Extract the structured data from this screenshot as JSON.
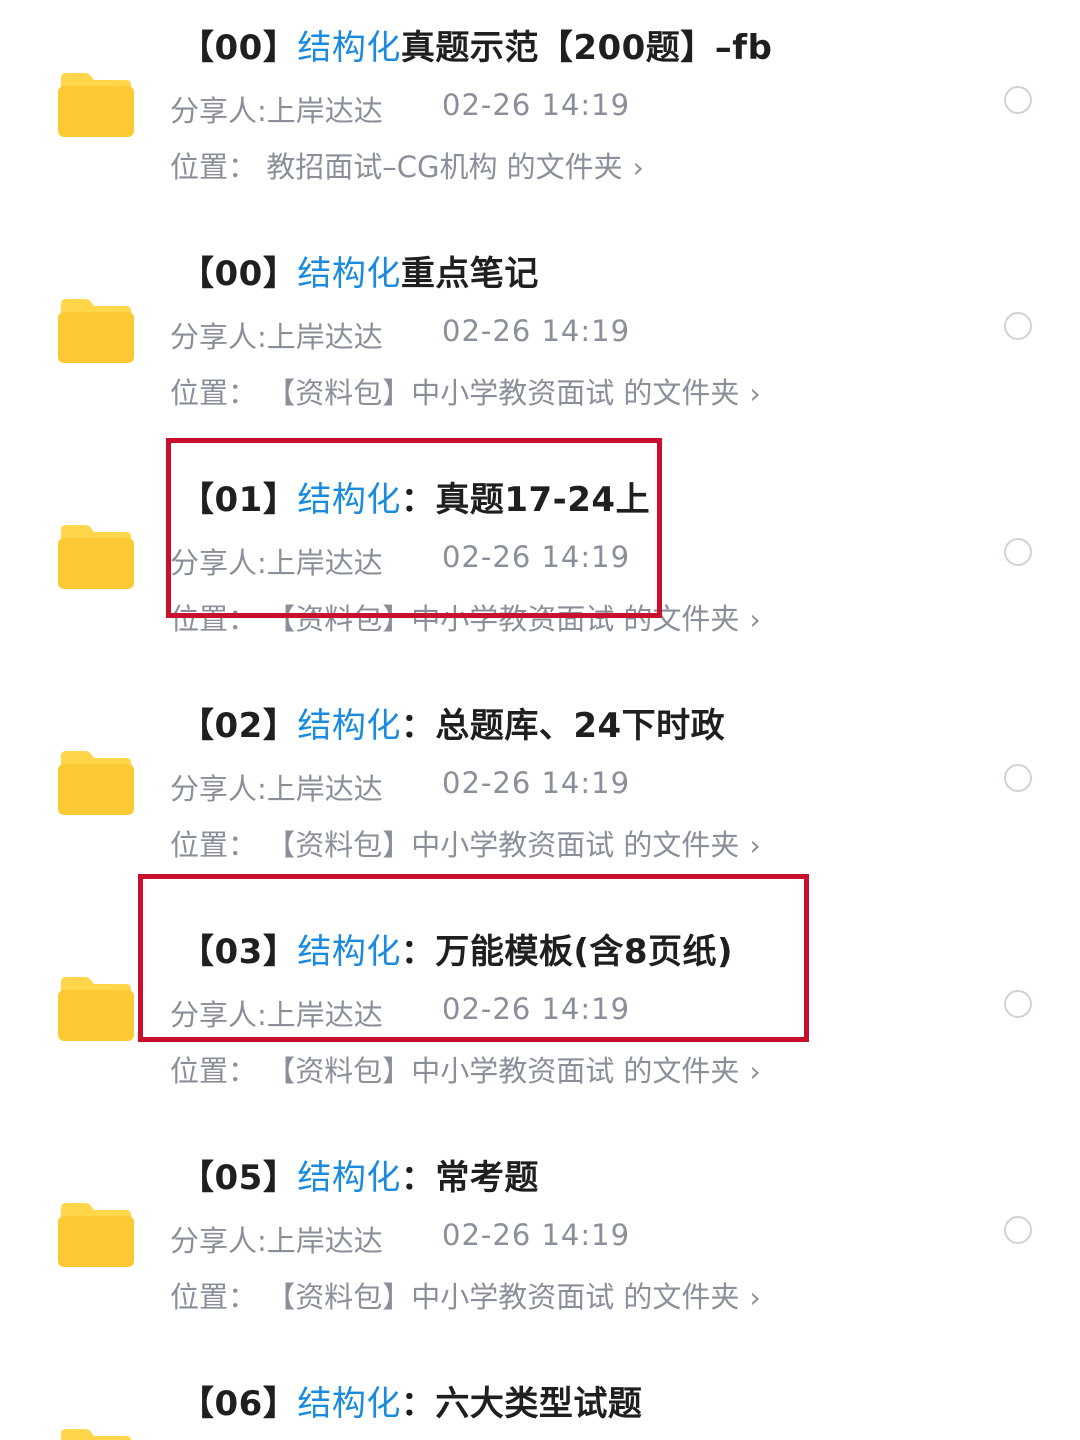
{
  "items": [
    {
      "prefix": "【00】",
      "keyword": "结构化",
      "rest": "真题示范【200题】–fb",
      "sharer": "分享人:上岸达达",
      "time": "02-26 14:19",
      "location": "位置：  教招面试–CG机构 的文件夹",
      "chevron": "›"
    },
    {
      "prefix": "【00】",
      "keyword": "结构化",
      "rest": "重点笔记",
      "sharer": "分享人:上岸达达",
      "time": "02-26 14:19",
      "location": "位置：  【资料包】中小学教资面试 的文件夹",
      "chevron": "›"
    },
    {
      "prefix": "【01】",
      "keyword": "结构化",
      "rest": "：真题17-24上",
      "sharer": "分享人:上岸达达",
      "time": "02-26 14:19",
      "location": "位置：  【资料包】中小学教资面试 的文件夹",
      "chevron": "›"
    },
    {
      "prefix": "【02】",
      "keyword": "结构化",
      "rest": "：总题库、24下时政",
      "sharer": "分享人:上岸达达",
      "time": "02-26 14:19",
      "location": "位置：  【资料包】中小学教资面试 的文件夹",
      "chevron": "›"
    },
    {
      "prefix": "【03】",
      "keyword": "结构化",
      "rest": "：万能模板(含8页纸)",
      "sharer": "分享人:上岸达达",
      "time": "02-26 14:19",
      "location": "位置：  【资料包】中小学教资面试 的文件夹",
      "chevron": "›"
    },
    {
      "prefix": "【05】",
      "keyword": "结构化",
      "rest": "：常考题",
      "sharer": "分享人:上岸达达",
      "time": "02-26 14:19",
      "location": "位置：  【资料包】中小学教资面试 的文件夹",
      "chevron": "›"
    },
    {
      "prefix": "【06】",
      "keyword": "结构化",
      "rest": "：六大类型试题"
    }
  ],
  "colors": {
    "keyword": "#1b8be0",
    "title": "#1f1f1f",
    "meta": "#8a8f99",
    "folder_top": "#ffd64a",
    "folder_body": "#fcc935",
    "highlight": "#c8102e",
    "radio_border": "#cfd2d8"
  },
  "icons": {
    "folder": "folder-icon",
    "radio": "radio-circle-icon",
    "chevron": "chevron-right-icon"
  }
}
